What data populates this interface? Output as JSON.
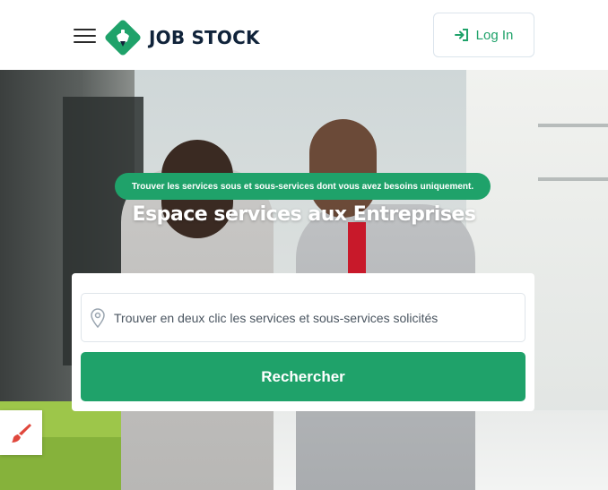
{
  "header": {
    "logo_text": "JOB STOCK",
    "login_label": "Log In"
  },
  "hero": {
    "badge": "Trouver les services sous et sous-services dont vous avez besoins uniquement.",
    "title": "Espace services aux Entreprises"
  },
  "search": {
    "placeholder": "Trouver en deux clic les services et sous-services solicités",
    "value": "",
    "button_label": "Rechercher"
  },
  "icons": {
    "menu": "hamburger-icon",
    "logo": "job-stock-logo",
    "login": "sign-in-icon",
    "location": "map-pin-icon",
    "tool": "paint-brush-icon"
  },
  "colors": {
    "brand_green": "#1fa26a",
    "dark_text": "#10233a",
    "brush_red": "#e0473c"
  }
}
